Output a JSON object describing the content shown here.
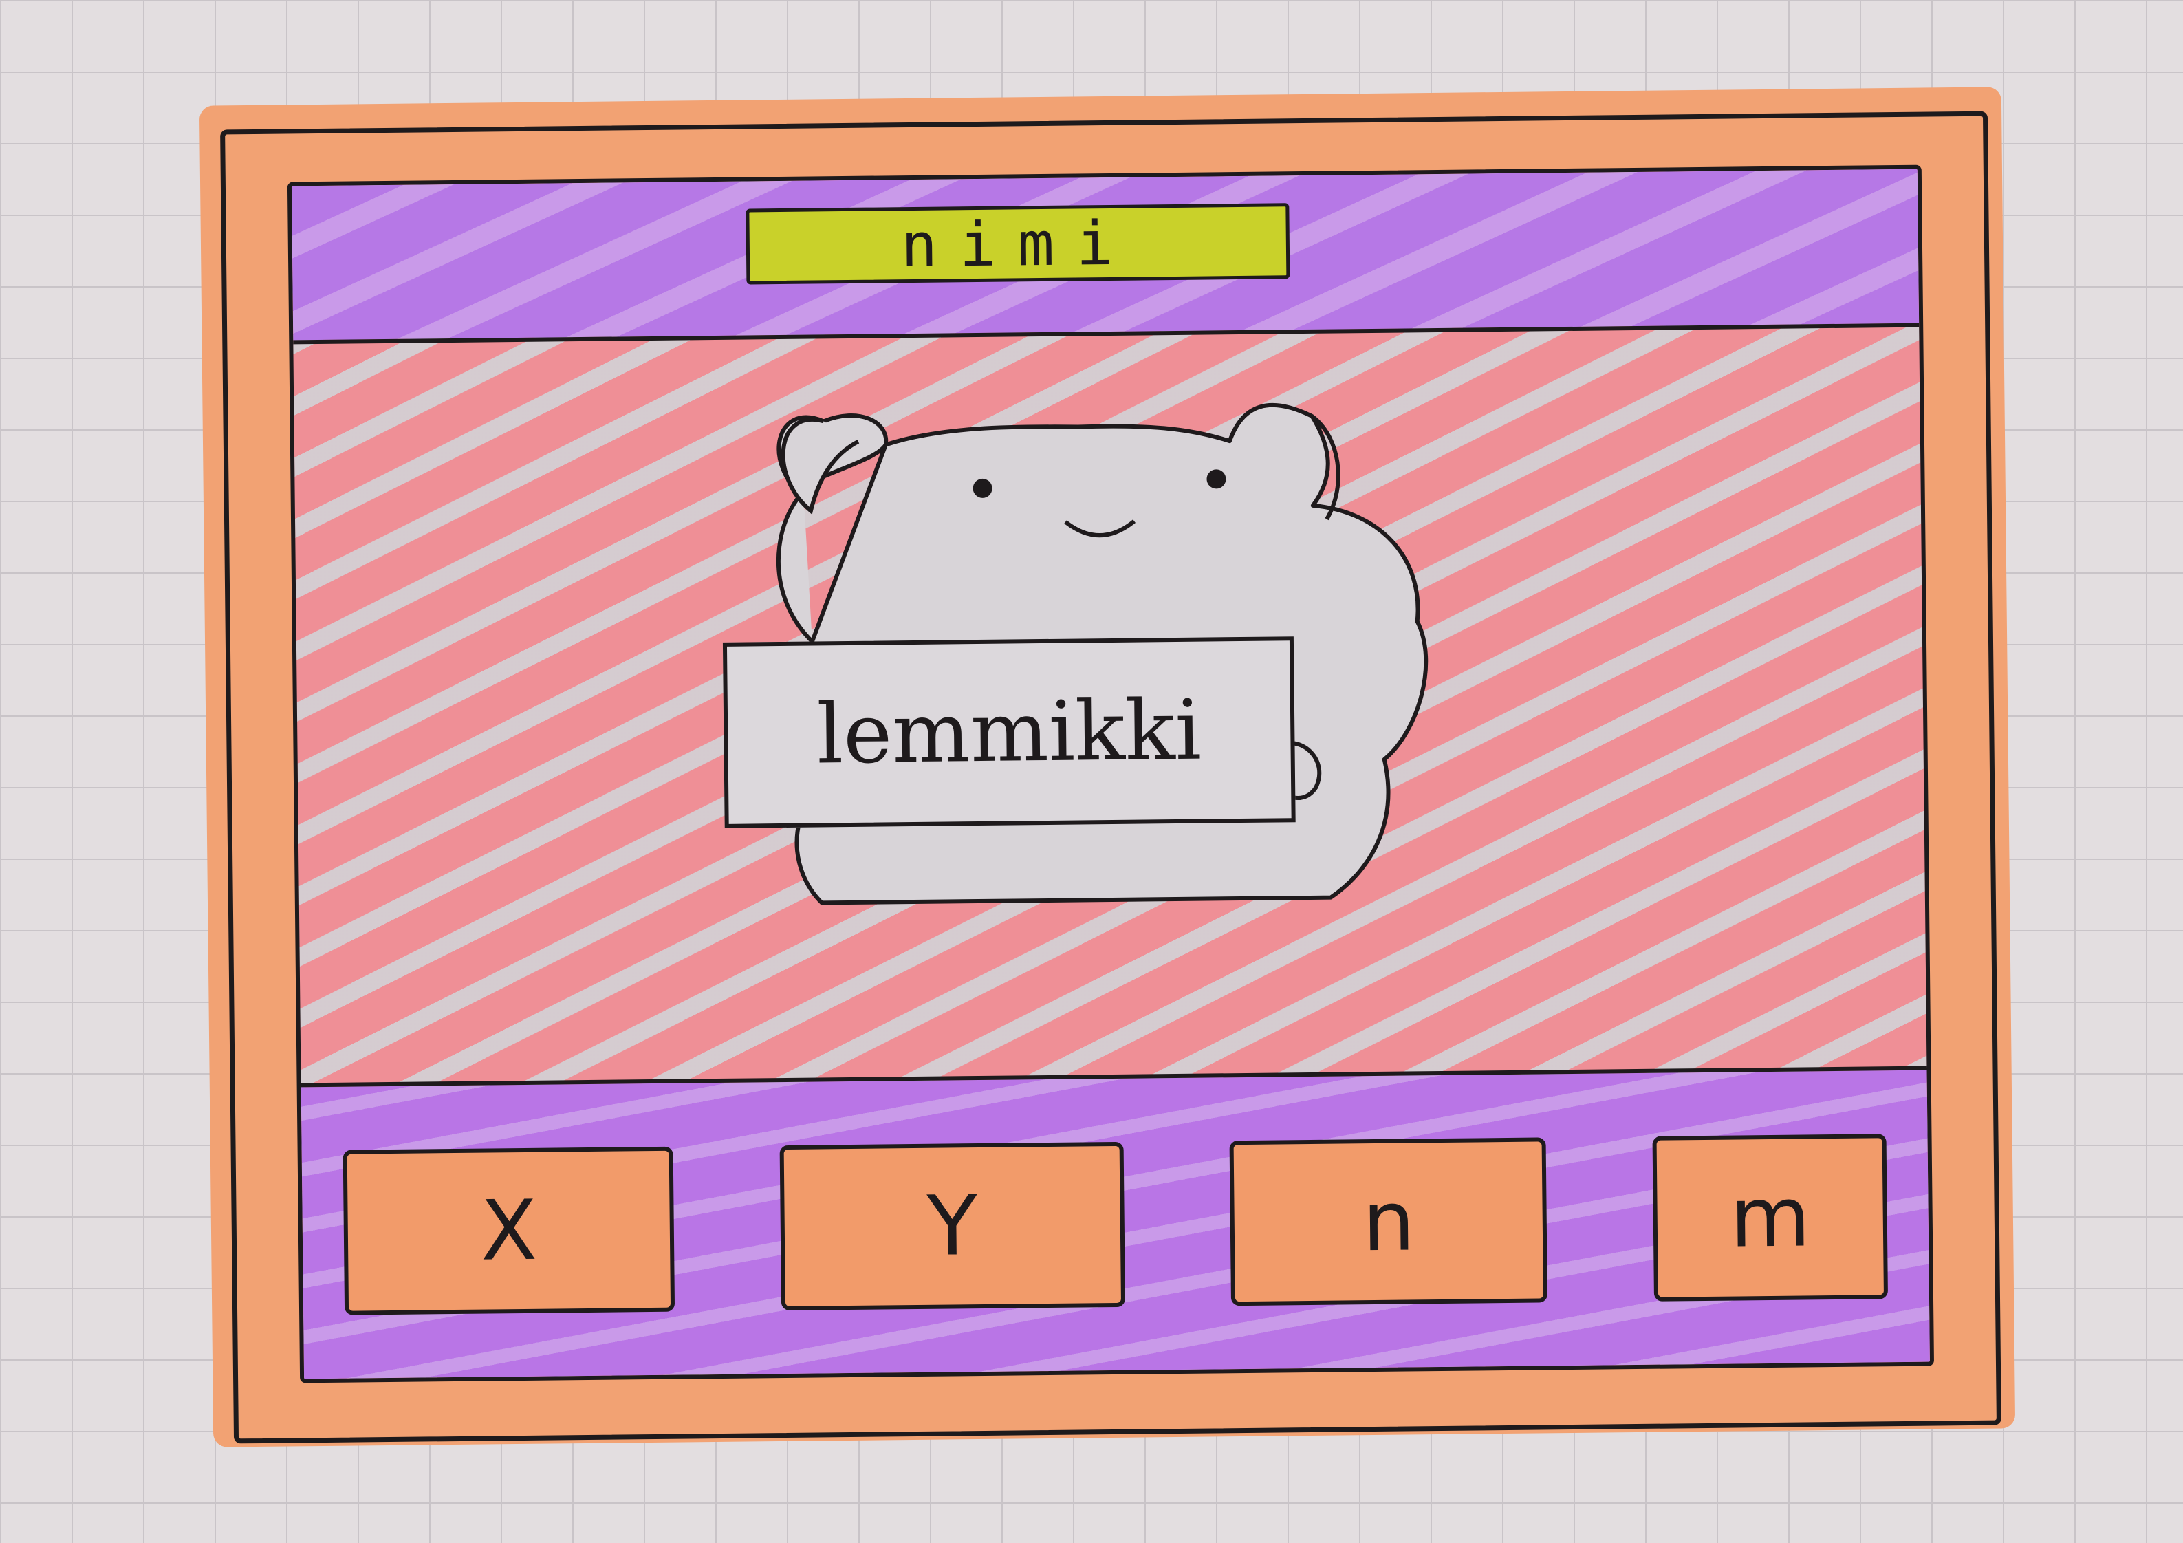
{
  "header": {
    "name_label": "nimi"
  },
  "pet": {
    "sign_text": "lemmikki"
  },
  "controls": {
    "buttons": [
      {
        "label": "X"
      },
      {
        "label": "Y"
      },
      {
        "label": "n"
      },
      {
        "label": "m"
      }
    ]
  },
  "colors": {
    "frame": "#f2a273",
    "header_bar": "#b678e6",
    "name_tab": "#c9d12a",
    "stage": "#ef8f96",
    "button": "#f29b6a"
  }
}
